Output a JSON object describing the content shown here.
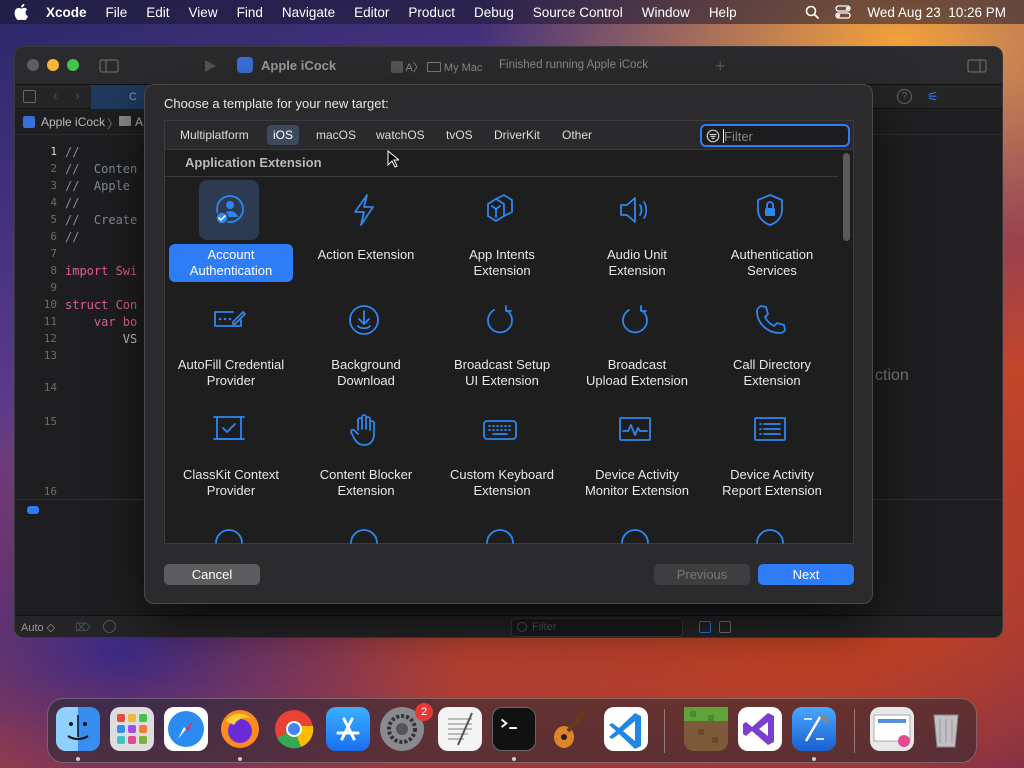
{
  "menubar": {
    "apple_icon": "apple-logo",
    "items": [
      "Xcode",
      "File",
      "Edit",
      "View",
      "Find",
      "Navigate",
      "Editor",
      "Product",
      "Debug",
      "Source Control",
      "Window",
      "Help"
    ],
    "clock": "Wed Aug 23  10:26 PM"
  },
  "xcode": {
    "scheme": "Apple iCock",
    "destination": "My Mac",
    "status": "Finished running Apple iCock",
    "breadcrumb": [
      "Apple iCock",
      "A"
    ],
    "tab_label": "C",
    "line_numbers": [
      "1",
      "2",
      "3",
      "4",
      "5",
      "6",
      "7",
      "8",
      "9",
      "10",
      "11",
      "12",
      "13",
      "14",
      "15",
      "16"
    ],
    "code_lines": [
      "//",
      "//  Conten",
      "//  Apple ",
      "//",
      "//  Create",
      "//",
      "",
      "import Swi",
      "",
      "struct Con",
      "    var bo",
      "        VS",
      "",
      "",
      "",
      ""
    ],
    "right_hint": "ction",
    "bottom_auto": "Auto ◇",
    "bottom_filter": "Filter"
  },
  "dialog": {
    "title": "Choose a template for your new target:",
    "tabs": [
      "Multiplatform",
      "iOS",
      "macOS",
      "watchOS",
      "tvOS",
      "DriverKit",
      "Other"
    ],
    "selected_tab": "iOS",
    "filter_placeholder": "Filter",
    "section": "Application Extension",
    "templates": [
      {
        "l1": "Account",
        "l2": "Authentication",
        "icon": "person-badge-icon",
        "selected": true
      },
      {
        "l1": "Action Extension",
        "l2": "",
        "icon": "bolt-icon"
      },
      {
        "l1": "App Intents",
        "l2": "Extension",
        "icon": "app-intents-icon"
      },
      {
        "l1": "Audio Unit",
        "l2": "Extension",
        "icon": "speaker-icon"
      },
      {
        "l1": "Authentication",
        "l2": "Services",
        "icon": "lock-shield-icon"
      },
      {
        "l1": "AutoFill Credential",
        "l2": "Provider",
        "icon": "password-field-icon"
      },
      {
        "l1": "Background",
        "l2": "Download",
        "icon": "download-circle-icon"
      },
      {
        "l1": "Broadcast Setup",
        "l2": "UI Extension",
        "icon": "broadcast-arrow-icon"
      },
      {
        "l1": "Broadcast",
        "l2": "Upload Extension",
        "icon": "broadcast-upload-icon"
      },
      {
        "l1": "Call Directory",
        "l2": "Extension",
        "icon": "phone-icon"
      },
      {
        "l1": "ClassKit Context",
        "l2": "Provider",
        "icon": "classkit-board-icon"
      },
      {
        "l1": "Content Blocker",
        "l2": "Extension",
        "icon": "hand-icon"
      },
      {
        "l1": "Custom Keyboard",
        "l2": "Extension",
        "icon": "keyboard-icon"
      },
      {
        "l1": "Device Activity",
        "l2": "Monitor Extension",
        "icon": "activity-monitor-icon"
      },
      {
        "l1": "Device Activity",
        "l2": "Report Extension",
        "icon": "activity-report-icon"
      }
    ],
    "cancel": "Cancel",
    "previous": "Previous",
    "next": "Next"
  },
  "dock": {
    "apps": [
      "finder-icon",
      "launchpad-icon",
      "safari-icon",
      "firefox-icon",
      "chrome-icon",
      "app-store-icon",
      "system-settings-icon",
      "textedit-icon",
      "terminal-icon",
      "garageband-icon",
      "vscode-icon",
      "minecraft-icon",
      "visual-studio-icon",
      "xcode-icon",
      "preview-icon",
      "trash-icon"
    ],
    "settings_badge": "2"
  },
  "colors": {
    "accent": "#2e7cf6",
    "icon": "#2e86f0",
    "panel": "#1e1e1e",
    "dialog": "#2b2b2d"
  }
}
